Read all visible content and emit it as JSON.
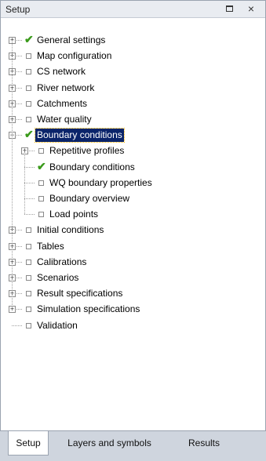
{
  "panel": {
    "title": "Setup"
  },
  "tree": [
    {
      "label": "General settings",
      "status": "check",
      "level": 0,
      "expander": "+"
    },
    {
      "label": "Map configuration",
      "status": "box",
      "level": 0,
      "expander": "+"
    },
    {
      "label": "CS network",
      "status": "box",
      "level": 0,
      "expander": "+"
    },
    {
      "label": "River network",
      "status": "box",
      "level": 0,
      "expander": "+"
    },
    {
      "label": "Catchments",
      "status": "box",
      "level": 0,
      "expander": "+"
    },
    {
      "label": "Water quality",
      "status": "box",
      "level": 0,
      "expander": "+"
    },
    {
      "label": "Boundary conditions",
      "status": "check",
      "level": 0,
      "expander": "-",
      "selected": true
    },
    {
      "label": "Repetitive profiles",
      "status": "box",
      "level": 1,
      "expander": "+"
    },
    {
      "label": "Boundary conditions",
      "status": "check",
      "level": 1,
      "expander": ""
    },
    {
      "label": "WQ boundary properties",
      "status": "box",
      "level": 1,
      "expander": ""
    },
    {
      "label": "Boundary overview",
      "status": "box",
      "level": 1,
      "expander": ""
    },
    {
      "label": "Load points",
      "status": "box",
      "level": 1,
      "expander": ""
    },
    {
      "label": "Initial conditions",
      "status": "box",
      "level": 0,
      "expander": "+"
    },
    {
      "label": "Tables",
      "status": "box",
      "level": 0,
      "expander": "+"
    },
    {
      "label": "Calibrations",
      "status": "box",
      "level": 0,
      "expander": "+"
    },
    {
      "label": "Scenarios",
      "status": "box",
      "level": 0,
      "expander": "+"
    },
    {
      "label": "Result specifications",
      "status": "box",
      "level": 0,
      "expander": "+"
    },
    {
      "label": "Simulation specifications",
      "status": "box",
      "level": 0,
      "expander": "+"
    },
    {
      "label": "Validation",
      "status": "box",
      "level": 0,
      "expander": ""
    }
  ],
  "tabs": [
    {
      "label": "Setup",
      "active": true
    },
    {
      "label": "Layers and symbols",
      "active": false
    },
    {
      "label": "Results",
      "active": false
    }
  ]
}
